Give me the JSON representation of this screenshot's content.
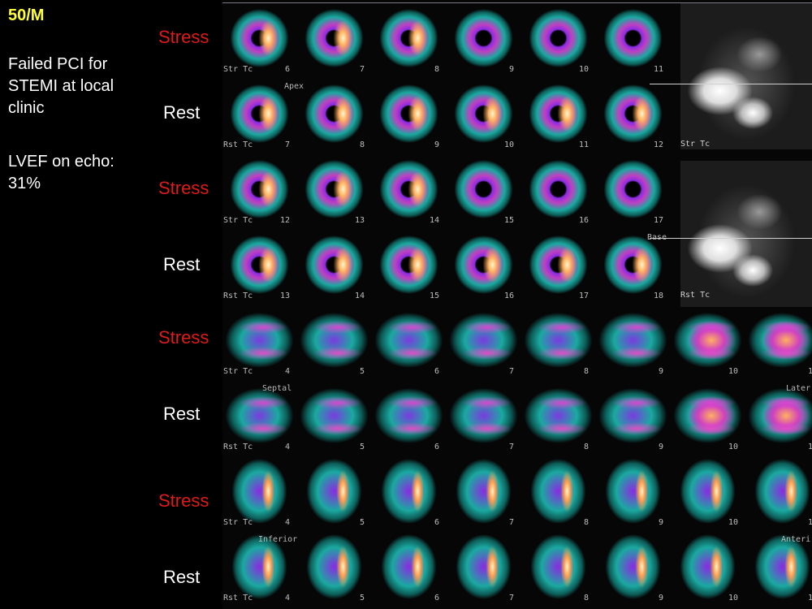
{
  "case": {
    "title": "50/M",
    "history": "Failed PCI for\nSTEMI at local\nclinic",
    "lvef": "LVEF on echo:\n31%"
  },
  "row_labels": [
    "Stress",
    "Rest",
    "Stress",
    "Rest",
    "Stress",
    "Rest",
    "Stress",
    "Rest"
  ],
  "row_prefixes": [
    "Str Tc",
    "Rst Tc",
    "Str Tc",
    "Rst Tc",
    "Str Tc",
    "Rst Tc",
    "Str Tc",
    "Rst Tc"
  ],
  "orientation_labels": {
    "apex": "Apex",
    "base": "Base",
    "septal": "Septal",
    "lateral": "Later",
    "inferior": "Inferior",
    "anterior": "Anteri"
  },
  "slice_numbers": [
    [
      "6",
      "7",
      "8",
      "9",
      "10",
      "11"
    ],
    [
      "7",
      "8",
      "9",
      "10",
      "11",
      "12"
    ],
    [
      "12",
      "13",
      "14",
      "15",
      "16",
      "17"
    ],
    [
      "13",
      "14",
      "15",
      "16",
      "17",
      "18"
    ],
    [
      "4",
      "5",
      "6",
      "7",
      "8",
      "9",
      "10",
      "1"
    ],
    [
      "4",
      "5",
      "6",
      "7",
      "8",
      "9",
      "10",
      "1"
    ],
    [
      "4",
      "5",
      "6",
      "7",
      "8",
      "9",
      "10",
      "1"
    ],
    [
      "4",
      "5",
      "6",
      "7",
      "8",
      "9",
      "10",
      "1"
    ]
  ],
  "planar_tags": [
    "Str Tc",
    "Rst Tc"
  ],
  "colors": {
    "title": "#ffff33",
    "stress": "#e01a1a",
    "rest": "#ffffff"
  }
}
